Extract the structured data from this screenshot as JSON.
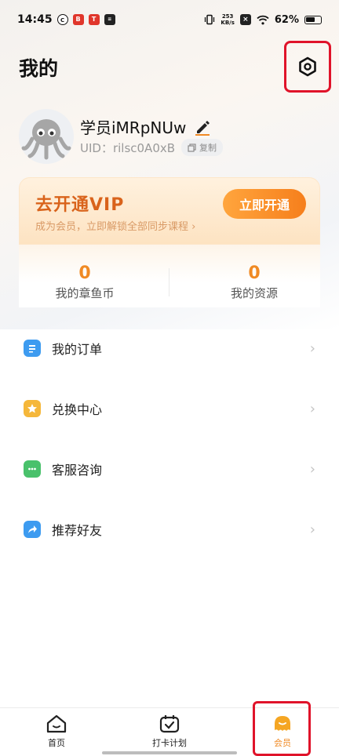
{
  "status_bar": {
    "time": "14:45",
    "net_speed_value": "253",
    "net_speed_unit": "KB/s",
    "battery": "62%"
  },
  "header": {
    "title": "我的"
  },
  "profile": {
    "username": "学员iMRpNUw",
    "uid": "UID：rilsc0A0xB",
    "copy_label": "复制"
  },
  "vip": {
    "title": "去开通VIP",
    "subtitle": "成为会员，立即解锁全部同步课程",
    "button": "立即开通"
  },
  "stats": [
    {
      "value": "0",
      "label": "我的章鱼币"
    },
    {
      "value": "0",
      "label": "我的资源"
    }
  ],
  "menu": [
    {
      "label": "我的订单",
      "icon": "order-icon",
      "color": "#3d9bf0"
    },
    {
      "label": "兑换中心",
      "icon": "exchange-icon",
      "color": "#f5b73a"
    },
    {
      "label": "客服咨询",
      "icon": "chat-icon",
      "color": "#49c16b"
    },
    {
      "label": "推荐好友",
      "icon": "share-icon",
      "color": "#3d9bf0"
    }
  ],
  "tabs": [
    {
      "label": "首页",
      "icon": "home-icon"
    },
    {
      "label": "打卡计划",
      "icon": "calendar-check-icon"
    },
    {
      "label": "会员",
      "icon": "member-icon",
      "active": true
    }
  ],
  "colors": {
    "accent": "#f67f1c",
    "highlight": "#e0132a"
  }
}
